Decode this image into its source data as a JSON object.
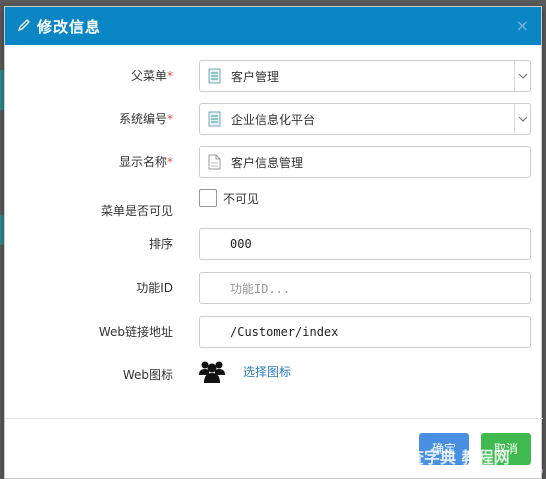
{
  "dialog": {
    "title": "修改信息",
    "close": "×"
  },
  "form": {
    "parent_menu": {
      "label": "父菜单",
      "required": "*",
      "value": "客户管理"
    },
    "system_code": {
      "label": "系统编号",
      "required": "*",
      "value": "企业信息化平台"
    },
    "display_name": {
      "label": "显示名称",
      "required": "*",
      "value": "客户信息管理"
    },
    "visible": {
      "label": "菜单是否可见",
      "option": "不可见"
    },
    "sort": {
      "label": "排序",
      "value": "000"
    },
    "function_id": {
      "label": "功能ID",
      "placeholder": "功能ID..."
    },
    "web_url": {
      "label": "Web链接地址",
      "value": "/Customer/index"
    },
    "web_icon": {
      "label": "Web图标",
      "link": "选择图标"
    }
  },
  "buttons": {
    "ok": "确定",
    "cancel": "取消"
  },
  "watermark": {
    "text": "查字典 教程网",
    "sub": "jiaocheng.chazidian.com"
  },
  "colors": {
    "header": "#0a86c5",
    "ok_button": "#4a90e2",
    "cancel_button": "#3fb950",
    "link": "#2a7fc0",
    "required": "#d9534f"
  }
}
